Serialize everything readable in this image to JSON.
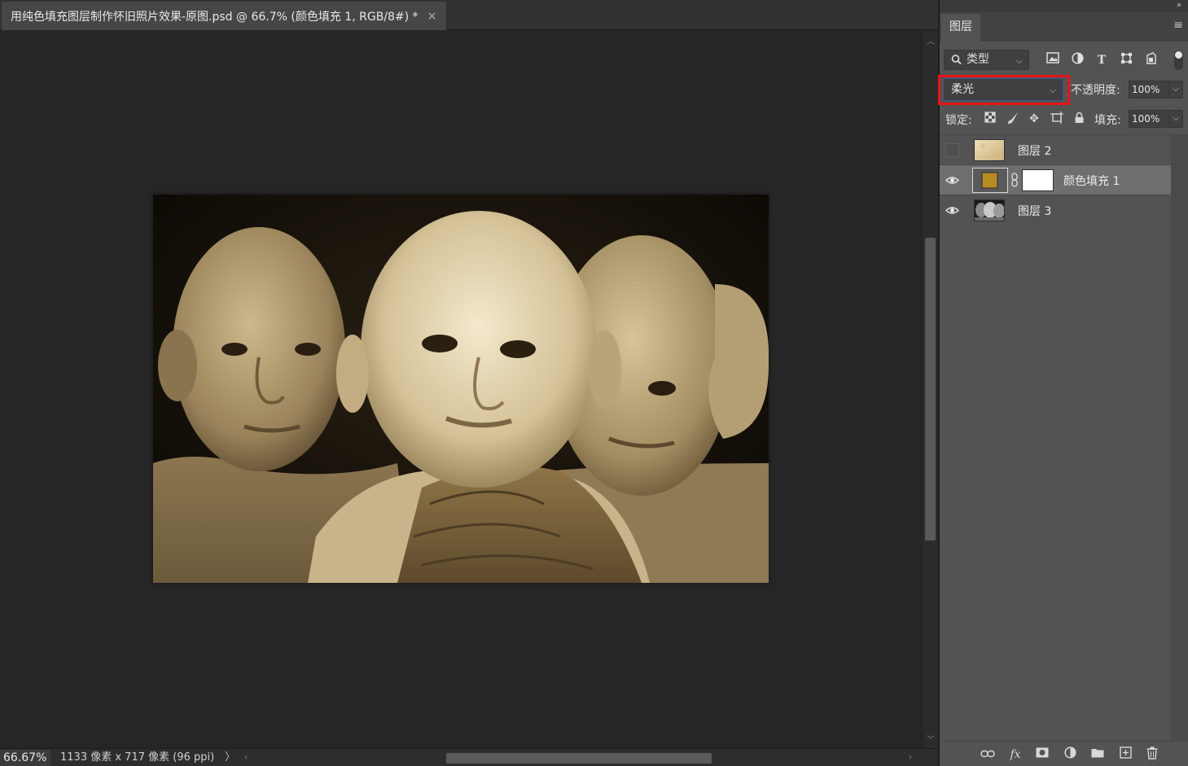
{
  "document": {
    "tab_title": "用纯色填充图层制作怀旧照片效果-原图.psd @ 66.7% (颜色填充 1, RGB/8#) *",
    "close_glyph": "×"
  },
  "status": {
    "zoom": "66.67%",
    "doc_info": "1133 像素 x 717 像素 (96 ppi)",
    "arrow": "〉"
  },
  "layers_panel": {
    "tab_label": "图层",
    "filter": {
      "kind_label": "类型",
      "icons": [
        "image-filter-icon",
        "adjustment-filter-icon",
        "type-filter-icon",
        "shape-filter-icon",
        "smart-object-filter-icon"
      ]
    },
    "blend_mode": "柔光",
    "opacity_label": "不透明度:",
    "opacity_value": "100%",
    "lock_label": "锁定:",
    "fill_label": "填充:",
    "fill_value": "100%",
    "layers": [
      {
        "name": "图层 2",
        "visible": false,
        "selected": false,
        "thumb": "paper"
      },
      {
        "name": "颜色填充 1",
        "visible": true,
        "selected": true,
        "thumb": "color",
        "fill_color": "#b78b23",
        "has_mask": true
      },
      {
        "name": "图层 3",
        "visible": true,
        "selected": false,
        "thumb": "photo"
      }
    ],
    "highlight_color": "#e8141a"
  },
  "colors": {
    "sepia_mid": "#a08c63",
    "sepia_light": "#e6d9b3",
    "background": "#262626"
  }
}
